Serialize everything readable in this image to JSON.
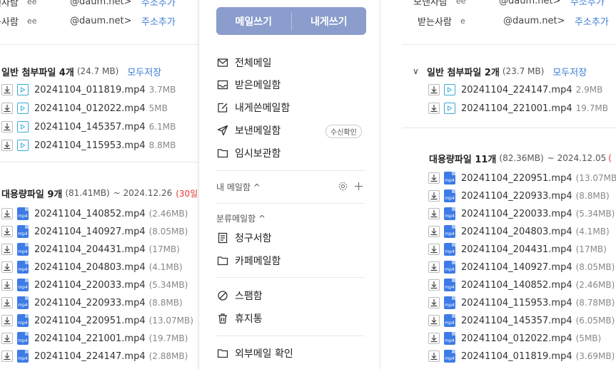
{
  "left": {
    "header": {
      "sender_label": "보낸사람",
      "sender_name": "ee",
      "sender_email": "@daum.net>",
      "receiver_label": "받는사람",
      "receiver_name": "ee",
      "receiver_email": "@daum.net>",
      "add_label": "주소추가"
    },
    "attach": {
      "title": "일반 첨부파일 4개",
      "size": "(24.7 MB)",
      "save_all": "모두저장",
      "files": [
        {
          "name": "20241104_011819.mp4",
          "size": "3.7MB"
        },
        {
          "name": "20241104_012022.mp4",
          "size": "5MB"
        },
        {
          "name": "20241104_145357.mp4",
          "size": "6.1MB"
        },
        {
          "name": "20241104_115953.mp4",
          "size": "8.8MB"
        }
      ]
    },
    "bigfiles": {
      "title": "대용량파일 9개",
      "size": "(81.41MB)",
      "date": "~ 2024.12.26",
      "days": "(30일",
      "files": [
        {
          "name": "20241104_140852.mp4",
          "size": "(2.46MB)"
        },
        {
          "name": "20241104_140927.mp4",
          "size": "(8.05MB)"
        },
        {
          "name": "20241104_204431.mp4",
          "size": "(17MB)"
        },
        {
          "name": "20241104_204803.mp4",
          "size": "(4.1MB)"
        },
        {
          "name": "20241104_220033.mp4",
          "size": "(5.34MB)"
        },
        {
          "name": "20241104_220933.mp4",
          "size": "(8.8MB)"
        },
        {
          "name": "20241104_220951.mp4",
          "size": "(13.07MB)"
        },
        {
          "name": "20241104_221001.mp4",
          "size": "(19.7MB)"
        },
        {
          "name": "20241104_224147.mp4",
          "size": "(2.88MB)"
        }
      ]
    }
  },
  "sidebar": {
    "write_mail": "메일쓰기",
    "write_self": "내게쓰기",
    "menu": [
      {
        "label": "전체메일",
        "icon": "envelope-icon"
      },
      {
        "label": "받은메일함",
        "icon": "inbox-icon"
      },
      {
        "label": "내게쓴메일함",
        "icon": "edit-icon"
      },
      {
        "label": "보낸메일함",
        "icon": "send-icon"
      },
      {
        "label": "임시보관함",
        "icon": "folder-icon"
      }
    ],
    "read_receipt": "수신확인",
    "my_mailbox": "내 메일함 ^",
    "category_mailbox": "분류메일함 ^",
    "category_items": [
      {
        "label": "청구서함",
        "icon": "receipt-icon"
      },
      {
        "label": "카페메일함",
        "icon": "folder-icon"
      }
    ],
    "spam": "스팸함",
    "trash": "휴지통",
    "external": "외부메일 확인"
  },
  "right": {
    "header": {
      "sender_label": "보낸사람",
      "sender_name": "ee",
      "sender_email": "@daum.net>",
      "receiver_label": "받는사람",
      "receiver_name": "e",
      "receiver_email": "@daum.net>",
      "add_label": "주소추가"
    },
    "attach": {
      "title": "일반 첨부파일 2개",
      "size": "(23.7 MB)",
      "save_all": "모두저장",
      "files": [
        {
          "name": "20241104_224147.mp4",
          "size": "2.9MB"
        },
        {
          "name": "20241104_221001.mp4",
          "size": "19.7MB"
        }
      ]
    },
    "bigfiles": {
      "title": "대용량파일 11개",
      "size": "(82.36MB)",
      "date": "~ 2024.12.05",
      "days": "(",
      "files": [
        {
          "name": "20241104_220951.mp4",
          "size": "(13.07MB)"
        },
        {
          "name": "20241104_220933.mp4",
          "size": "(8.8MB)"
        },
        {
          "name": "20241104_220033.mp4",
          "size": "(5.34MB)"
        },
        {
          "name": "20241104_204803.mp4",
          "size": "(4.1MB)"
        },
        {
          "name": "20241104_204431.mp4",
          "size": "(17MB)"
        },
        {
          "name": "20241104_140927.mp4",
          "size": "(8.05MB)"
        },
        {
          "name": "20241104_140852.mp4",
          "size": "(2.46MB)"
        },
        {
          "name": "20241104_115953.mp4",
          "size": "(8.78MB)"
        },
        {
          "name": "20241104_145357.mp4",
          "size": "(6.05MB)"
        },
        {
          "name": "20241104_012022.mp4",
          "size": "(5MB)"
        },
        {
          "name": "20241104_011819.mp4",
          "size": "(3.69MB)"
        }
      ]
    }
  }
}
